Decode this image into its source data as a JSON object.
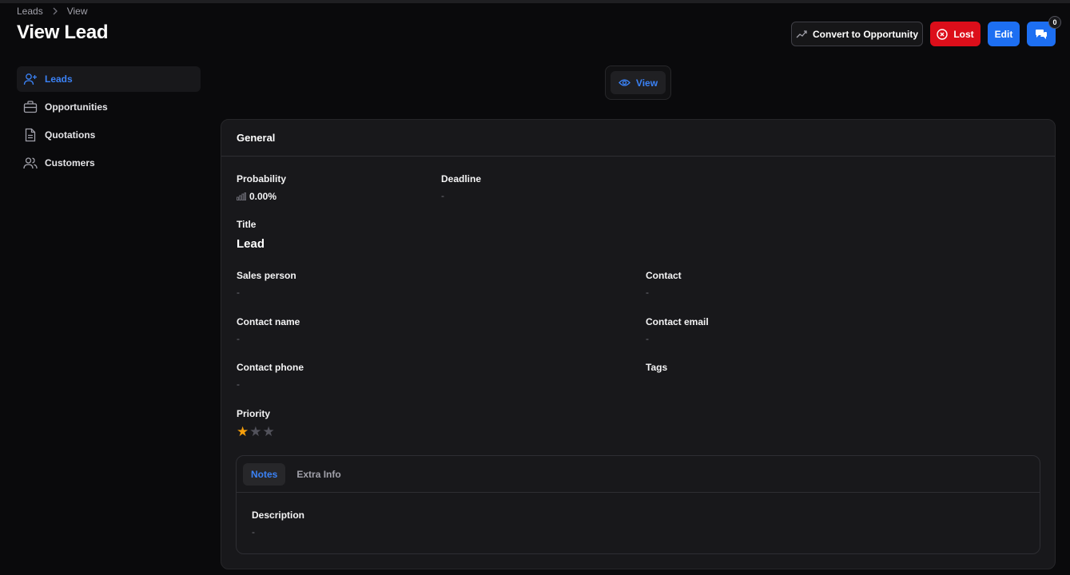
{
  "breadcrumb": {
    "items": [
      "Leads",
      "View"
    ]
  },
  "header": {
    "title": "View Lead"
  },
  "actions": {
    "convert_label": "Convert to Opportunity",
    "lost_label": "Lost",
    "edit_label": "Edit",
    "chat_count": "0"
  },
  "sidebar": {
    "items": [
      {
        "label": "Leads",
        "icon": "user-plus-icon",
        "active": true
      },
      {
        "label": "Opportunities",
        "icon": "briefcase-icon",
        "active": false
      },
      {
        "label": "Quotations",
        "icon": "document-icon",
        "active": false
      },
      {
        "label": "Customers",
        "icon": "users-icon",
        "active": false
      }
    ]
  },
  "view_tab": {
    "label": "View"
  },
  "general": {
    "heading": "General",
    "probability": {
      "label": "Probability",
      "value": "0.00%"
    },
    "deadline": {
      "label": "Deadline",
      "value": "-"
    },
    "title": {
      "label": "Title",
      "value": "Lead"
    },
    "sales_person": {
      "label": "Sales person",
      "value": "-"
    },
    "contact": {
      "label": "Contact",
      "value": "-"
    },
    "contact_name": {
      "label": "Contact name",
      "value": "-"
    },
    "contact_email": {
      "label": "Contact email",
      "value": "-"
    },
    "contact_phone": {
      "label": "Contact phone",
      "value": "-"
    },
    "tags": {
      "label": "Tags"
    },
    "priority": {
      "label": "Priority",
      "rating": 1,
      "max": 3
    }
  },
  "notes": {
    "tabs": [
      "Notes",
      "Extra Info"
    ],
    "active_tab": 0,
    "description": {
      "label": "Description",
      "value": "-"
    }
  },
  "colors": {
    "accent": "#3b82f6",
    "danger": "#dc0e1a",
    "primary": "#1d6ff2",
    "star_active": "#f59e0b",
    "star_inactive": "#52525b"
  }
}
